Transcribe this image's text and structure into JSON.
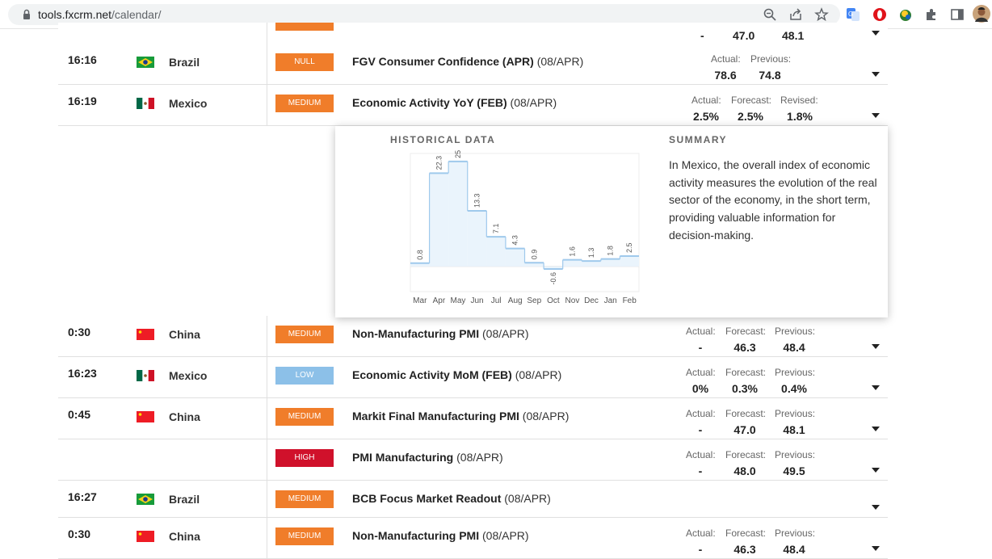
{
  "browser": {
    "url_host": "tools.fxcrm.net",
    "url_path": "/calendar/",
    "icons": [
      "lock-icon",
      "zoom-icon",
      "share-icon",
      "star-icon",
      "translate-icon",
      "opera-icon",
      "globe-icon",
      "puzzle-icon",
      "sidepanel-icon",
      "profile-avatar"
    ]
  },
  "partial_row": {
    "actual": "-",
    "forecast": "47.0",
    "previous": "48.1"
  },
  "rows": [
    {
      "time": "16:16",
      "country": "Brazil",
      "flag": "brazil",
      "impact": "NULL",
      "event_title": "FGV Consumer Confidence (APR)",
      "event_date": "(08/APR)",
      "stats": [
        {
          "label": "Actual:",
          "value": "78.6"
        },
        {
          "label": "Previous:",
          "value": "74.8"
        }
      ]
    },
    {
      "time": "16:19",
      "country": "Mexico",
      "flag": "mexico",
      "impact": "MEDIUM",
      "event_title": "Economic Activity YoY (FEB)",
      "event_date": "(08/APR)",
      "stats": [
        {
          "label": "Actual:",
          "value": "2.5%"
        },
        {
          "label": "Forecast:",
          "value": "2.5%"
        },
        {
          "label": "Revised:",
          "value": "1.8%"
        }
      ]
    },
    {
      "time": "0:30",
      "country": "China",
      "flag": "china",
      "impact": "MEDIUM",
      "event_title": "Non-Manufacturing PMI",
      "event_date": "(08/APR)",
      "stats": [
        {
          "label": "Actual:",
          "value": "-"
        },
        {
          "label": "Forecast:",
          "value": "46.3"
        },
        {
          "label": "Previous:",
          "value": "48.4"
        }
      ]
    },
    {
      "time": "16:23",
      "country": "Mexico",
      "flag": "mexico",
      "impact": "LOW",
      "event_title": "Economic Activity MoM (FEB)",
      "event_date": "(08/APR)",
      "stats": [
        {
          "label": "Actual:",
          "value": "0%"
        },
        {
          "label": "Forecast:",
          "value": "0.3%"
        },
        {
          "label": "Previous:",
          "value": "0.4%"
        }
      ]
    },
    {
      "time": "0:45",
      "country": "China",
      "flag": "china",
      "impact": "MEDIUM",
      "event_title": "Markit Final Manufacturing PMI",
      "event_date": "(08/APR)",
      "stats": [
        {
          "label": "Actual:",
          "value": "-"
        },
        {
          "label": "Forecast:",
          "value": "47.0"
        },
        {
          "label": "Previous:",
          "value": "48.1"
        }
      ]
    },
    {
      "time": "",
      "country": "",
      "flag": "",
      "impact": "HIGH",
      "event_title": "PMI Manufacturing",
      "event_date": "(08/APR)",
      "stats": [
        {
          "label": "Actual:",
          "value": "-"
        },
        {
          "label": "Forecast:",
          "value": "48.0"
        },
        {
          "label": "Previous:",
          "value": "49.5"
        }
      ]
    },
    {
      "time": "16:27",
      "country": "Brazil",
      "flag": "brazil",
      "impact": "MEDIUM",
      "event_title": "BCB Focus Market Readout",
      "event_date": "(08/APR)",
      "stats": []
    },
    {
      "time": "0:30",
      "country": "China",
      "flag": "china",
      "impact": "MEDIUM",
      "event_title": "Non-Manufacturing PMI",
      "event_date": "(08/APR)",
      "stats": [
        {
          "label": "Actual:",
          "value": "-"
        },
        {
          "label": "Forecast:",
          "value": "46.3"
        },
        {
          "label": "Previous:",
          "value": "48.4"
        }
      ]
    }
  ],
  "popup": {
    "historical_title": "HISTORICAL DATA",
    "summary_title": "SUMMARY",
    "summary_text": "In Mexico, the overall index of economic activity measures the evolution of the real sector of the economy, in the short term, providing valuable information for decision-making."
  },
  "colors": {
    "medium": "#f07d2a",
    "low": "#8cc0e8",
    "high": "#d0112b",
    "null": "#f07d2a",
    "chart_line": "#9fc9ec"
  },
  "chart_data": {
    "type": "area",
    "categories": [
      "Mar",
      "Apr",
      "May",
      "Jun",
      "Jul",
      "Aug",
      "Sep",
      "Oct",
      "Nov",
      "Dec",
      "Jan",
      "Feb"
    ],
    "values": [
      0.8,
      22.3,
      25.1,
      13.3,
      7.1,
      4.3,
      0.9,
      -0.6,
      1.6,
      1.3,
      1.8,
      2.5
    ],
    "value_labels": [
      "0.8",
      "22.3",
      "25.1",
      "13.3",
      "7.1",
      "4.3",
      "0.9",
      "-0.6",
      "1.6",
      "1.3",
      "1.8",
      "2.5"
    ],
    "title": "HISTORICAL DATA",
    "xlabel": "",
    "ylabel": "",
    "ylim": [
      -6,
      27
    ],
    "step": true,
    "grid": false
  }
}
